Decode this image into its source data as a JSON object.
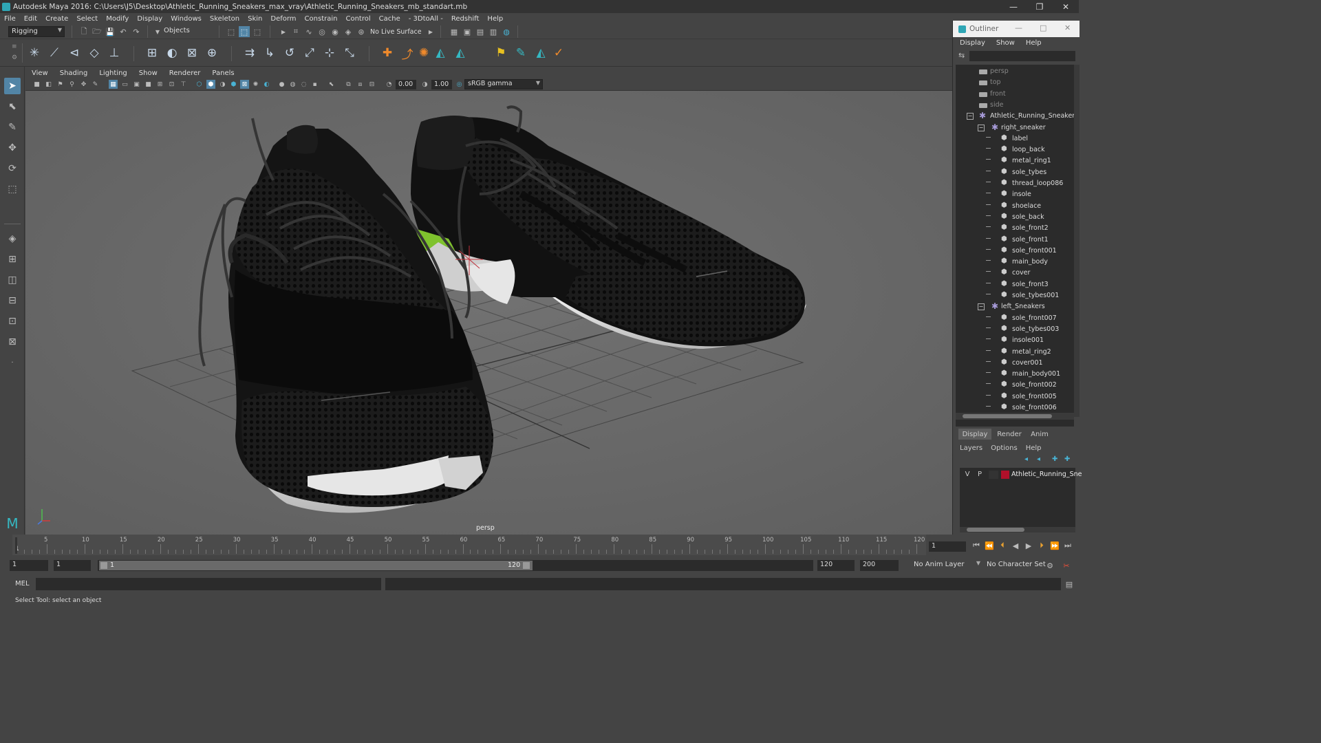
{
  "window": {
    "title": "Autodesk Maya 2016: C:\\Users\\J5\\Desktop\\Athletic_Running_Sneakers_max_vray\\Athletic_Running_Sneakers_mb_standart.mb",
    "minimize": "—",
    "restore": "❐",
    "close": "✕"
  },
  "menubar": [
    "File",
    "Edit",
    "Create",
    "Select",
    "Modify",
    "Display",
    "Windows",
    "Skeleton",
    "Skin",
    "Deform",
    "Constrain",
    "Control",
    "Cache",
    "- 3DtoAll -",
    "Redshift",
    "Help"
  ],
  "statusline": {
    "mode": "Rigging",
    "selection_mode": "Objects",
    "live_surface": "No Live Surface"
  },
  "viewport": {
    "menu": [
      "View",
      "Shading",
      "Lighting",
      "Show",
      "Renderer",
      "Panels"
    ],
    "exposure": "0.00",
    "gamma": "1.00",
    "color_space": "sRGB gamma",
    "camera_label": "persp"
  },
  "outliner": {
    "title": "Outliner",
    "menu": [
      "Display",
      "Show",
      "Help"
    ],
    "cameras": [
      "persp",
      "top",
      "front",
      "side"
    ],
    "root": "Athletic_Running_Sneakers_r",
    "groups": [
      {
        "name": "right_sneaker",
        "children": [
          "label",
          "loop_back",
          "metal_ring1",
          "sole_tybes",
          "thread_loop086",
          "insole",
          "shoelace",
          "sole_back",
          "sole_front2",
          "sole_front1",
          "sole_front001",
          "main_body",
          "cover",
          "sole_front3",
          "sole_tybes001"
        ]
      },
      {
        "name": "left_Sneakers",
        "children": [
          "sole_front007",
          "sole_tybes003",
          "insole001",
          "metal_ring2",
          "cover001",
          "main_body001",
          "sole_front002",
          "sole_front005",
          "sole_front006"
        ]
      }
    ]
  },
  "layers": {
    "tabs": [
      "Display",
      "Render",
      "Anim"
    ],
    "menu": [
      "Layers",
      "Options",
      "Help"
    ],
    "layer": {
      "v": "V",
      "p": "P",
      "name": "Athletic_Running_Sne",
      "color": "#b0102a"
    }
  },
  "timeline": {
    "ticks": [
      5,
      10,
      15,
      20,
      25,
      30,
      35,
      40,
      45,
      50,
      55,
      60,
      65,
      70,
      75,
      80,
      85,
      90,
      95,
      100,
      105,
      110,
      115,
      120
    ],
    "start_label": "1",
    "current_frame": "1"
  },
  "range": {
    "start": "1",
    "playback_start": "1",
    "slider_start": "1",
    "slider_end": "120",
    "playback_end": "120",
    "end": "200",
    "anim_layer": "No Anim Layer",
    "character_set": "No Character Set"
  },
  "command": {
    "lang": "MEL"
  },
  "help": {
    "text": "Select Tool: select an object"
  },
  "colors": {
    "accent": "#5285a6",
    "sole_green": "#7fc22e"
  }
}
